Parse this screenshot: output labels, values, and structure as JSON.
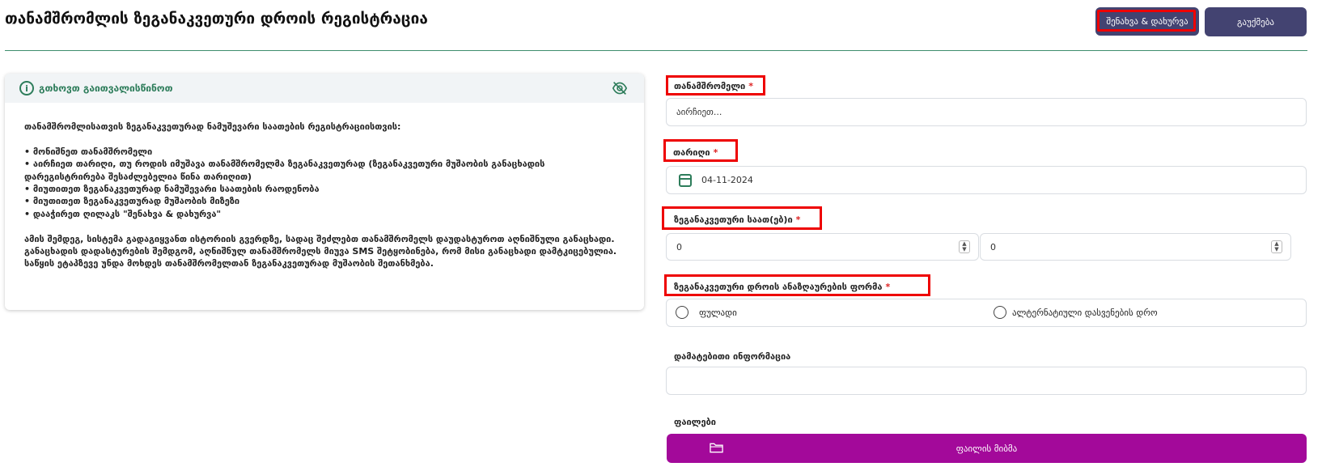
{
  "header": {
    "title": "თანამშრომლის ზეგანაკვეთური დროის რეგისტრაცია",
    "save_button": "შენახვა & დახურვა",
    "cancel_button": "გაუქმება"
  },
  "info_panel": {
    "title": "გთხოვთ გაითვალისწინოთ",
    "icon": "info-icon",
    "toggle_icon": "eye-off-icon",
    "body": "თანამშრომლისათვის ზეგანაკვეთურად ნამუშევარი საათების რეგისტრაციისთვის:\n\n• მონიშნეთ თანამშრომელი\n• აირჩიეთ თარიღი, თუ როდის იმუშავა თანამშრომელმა ზეგანაკვეთურად (ზეგანაკვეთური მუშაობის განაცხადის დარეგისტრირება შესაძლებელია წინა თარიღით)\n• მიუთითეთ ზეგანაკვეთურად ნამუშევარი საათების რაოდენობა\n• მიუთითეთ ზეგანაკვეთურად მუშაობის მიზეზი\n• დააჭირეთ ღილაკს \"შენახვა & დახურვა\"\n\nამის შემდეგ, სისტემა გადაგიყვანთ ისტორიის გვერდზე, სადაც შეძლებთ თანამშრომელს დაუდასტუროთ აღნიშნული განაცხადი.\nგანაცხადის დადასტურების შემდგომ, აღნიშნულ თანამშრომელს მიუვა SMS შეტყობინება, რომ მისი განაცხადი დამტკიცებულია.\nსაწყის ეტაპზევე უნდა მოხდეს თანამშრომელთან ზეგანაკვეთურად მუშაობის შეთანხმება."
  },
  "form": {
    "employee": {
      "label": "თანამშრომელი",
      "required_mark": "*",
      "placeholder": "აირჩიეთ..."
    },
    "date": {
      "label": "თარიღი",
      "required_mark": "*",
      "value": "04-11-2024",
      "icon": "calendar-icon"
    },
    "hours": {
      "label": "ზეგანაკვეთური საათ(ებ)ი",
      "required_mark": "*",
      "hours_value": "0",
      "minutes_value": "0"
    },
    "compensation": {
      "label": "ზეგანაკვეთური დროის ანაზღაურების ფორმა",
      "required_mark": "*",
      "options": [
        "ფულადი",
        "ალტერნატიული დასვენების დრო"
      ]
    },
    "additional_info": {
      "label": "დამატებითი ინფორმაცია",
      "value": ""
    },
    "files": {
      "label": "ფაილები",
      "button": "ფაილის მიბმა",
      "icon": "folder-icon"
    }
  },
  "colors": {
    "primary_button": "#434371",
    "accent_green": "#2e7d5b",
    "file_button": "#a3099a",
    "highlight_box": "#e00000"
  }
}
